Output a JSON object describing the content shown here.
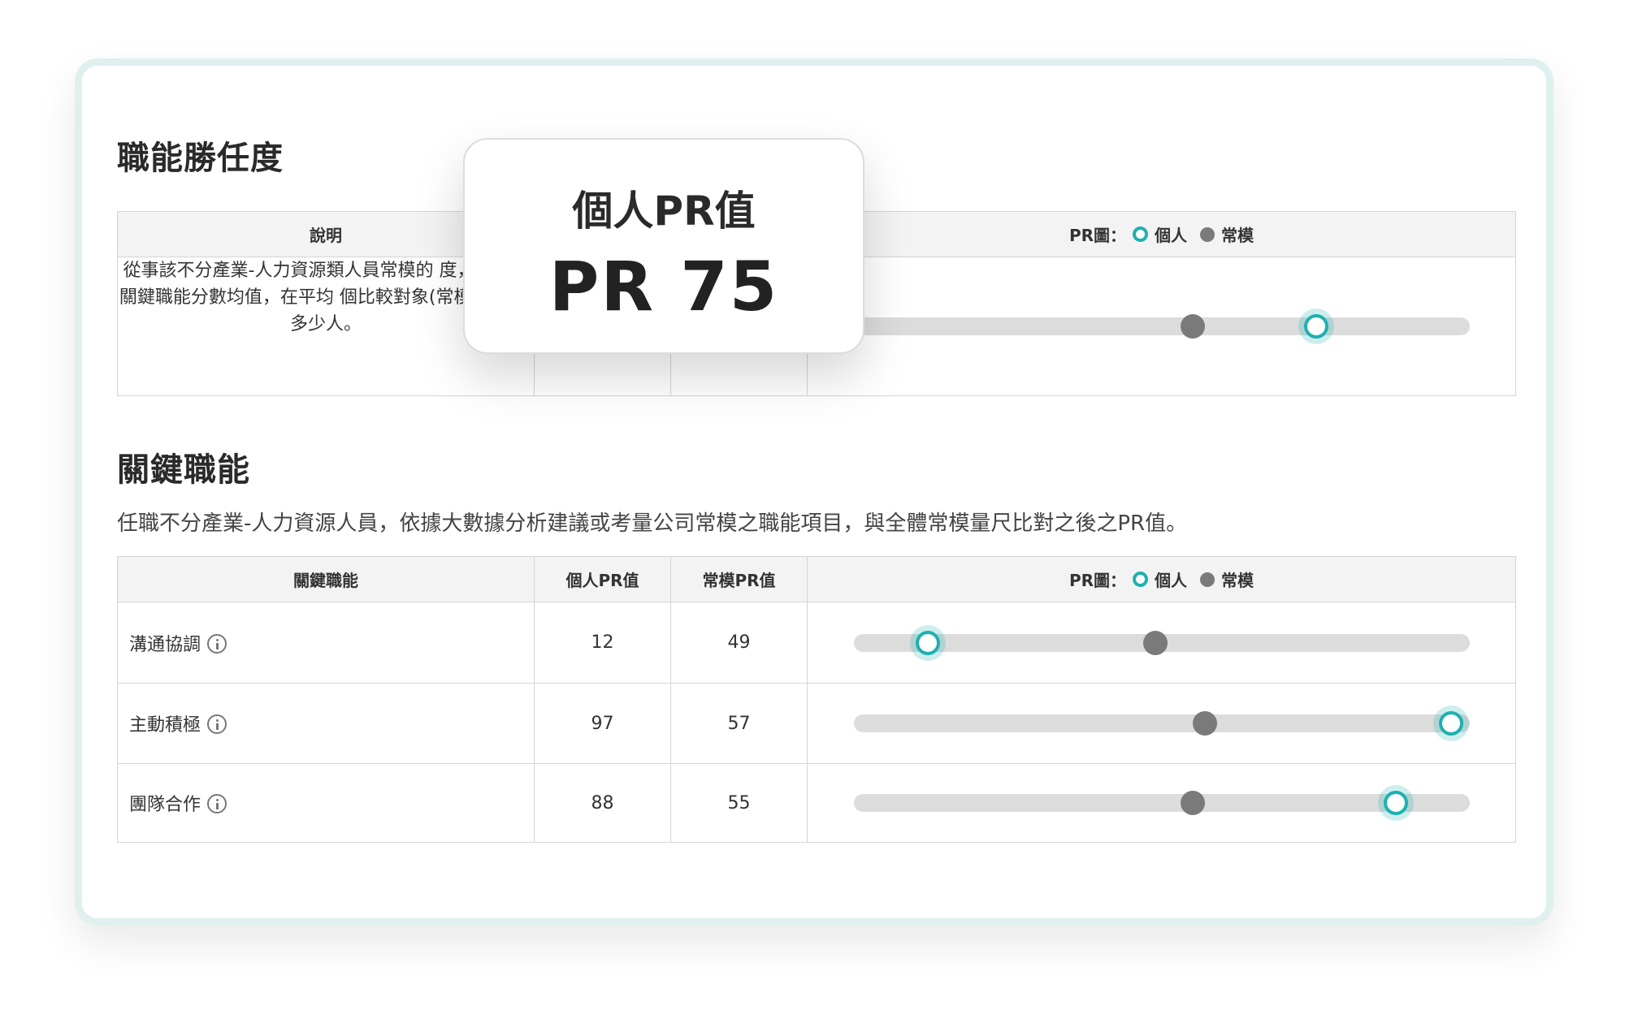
{
  "competency": {
    "title": "職能勝任度",
    "header_desc": "說明",
    "description": "從事該不分產業-人力資源類人員常模的 度，計算各關鍵職能分數均值，在平均 個比較對象(常模)中贏過多少人。",
    "pr_chart_label": "PR圖：",
    "legend_individual": "個人",
    "legend_norm": "常模",
    "individual_pr": 75,
    "norm_pr": 55
  },
  "popup": {
    "title": "個人PR值",
    "value": "PR 75"
  },
  "key": {
    "title": "關鍵職能",
    "description": "任職不分產業-人力資源人員，依據大數據分析建議或考量公司常模之職能項目，與全體常模量尺比對之後之PR值。",
    "columns": {
      "name": "關鍵職能",
      "individual": "個人PR值",
      "norm": "常模PR值",
      "chart": "PR圖：",
      "legend_individual": "個人",
      "legend_norm": "常模"
    },
    "rows": [
      {
        "name": "溝通協調",
        "individual": "12",
        "norm": "49"
      },
      {
        "name": "主動積極",
        "individual": "97",
        "norm": "57"
      },
      {
        "name": "團隊合作",
        "individual": "88",
        "norm": "55"
      }
    ]
  },
  "colors": {
    "accent": "#1fb0b1",
    "norm": "#7a7a7a",
    "track": "#dcdcdc"
  }
}
